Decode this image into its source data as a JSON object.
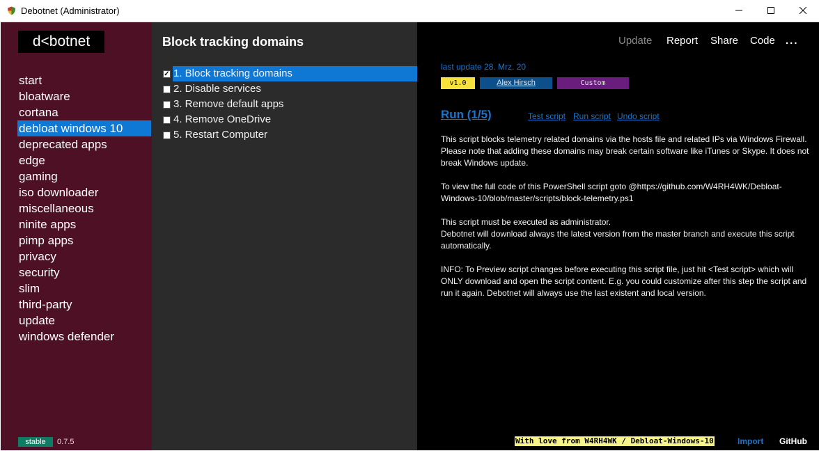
{
  "window": {
    "title": "Debotnet (Administrator)"
  },
  "sidebar": {
    "logo": "d<botnet",
    "items": [
      {
        "label": "start"
      },
      {
        "label": "bloatware"
      },
      {
        "label": "cortana"
      },
      {
        "label": "debloat windows 10",
        "active": true
      },
      {
        "label": "deprecated apps"
      },
      {
        "label": "edge"
      },
      {
        "label": "gaming"
      },
      {
        "label": "iso downloader"
      },
      {
        "label": "miscellaneous"
      },
      {
        "label": "ninite apps"
      },
      {
        "label": "pimp apps"
      },
      {
        "label": "privacy"
      },
      {
        "label": "security"
      },
      {
        "label": "slim"
      },
      {
        "label": "third-party"
      },
      {
        "label": "update"
      },
      {
        "label": "windows defender"
      }
    ],
    "channel": "stable",
    "version": "0.7.5"
  },
  "middle": {
    "heading": "Block tracking domains",
    "scripts": [
      {
        "label": "1. Block tracking domains",
        "checked": true,
        "selected": true
      },
      {
        "label": "2. Disable services",
        "checked": false
      },
      {
        "label": "3. Remove default apps",
        "checked": false
      },
      {
        "label": "4. Remove OneDrive",
        "checked": false
      },
      {
        "label": "5. Restart Computer",
        "checked": false
      }
    ]
  },
  "right": {
    "menu": {
      "update": "Update",
      "report": "Report",
      "share": "Share",
      "code": "Code",
      "more": "..."
    },
    "last_update": "last update 28. Mrz. 20",
    "tags": {
      "version": "v1.0",
      "author": "Alex Hirsch",
      "type": "Custom"
    },
    "run_label": "Run (1/5)",
    "actions": {
      "test": "Test script",
      "run": "Run script",
      "undo": "Undo script"
    },
    "description": [
      "This script blocks telemetry related domains via the hosts file and related IPs via Windows Firewall.",
      "Please note that adding these domains may break certain software like iTunes or Skype. It does not break Windows update.",
      "To view the full code of this PowerShell script goto @https://github.com/W4RH4WK/Debloat-Windows-10/blob/master/scripts/block-telemetry.ps1",
      "This script must be executed as administrator.",
      "Debotnet will download always the latest version from the master branch and execute this script automatically.",
      "INFO: To Preview script changes before executing this script file, just hit <Test script> which will ONLY download and open the script content. E.g. you could customize after this step the script and run it again. Debotnet will always use the last existent and local version."
    ],
    "footer": {
      "banner": "With love from W4RH4WK / Debloat-Windows-10",
      "import": "Import",
      "github": "GitHub"
    }
  },
  "colors": {
    "sidebar_bg": "#4d1024",
    "accent": "#0e78d4",
    "middle_bg": "#2b2b2b",
    "right_bg": "#000000",
    "link": "#1e73c8",
    "tag_version": "#f7e23c",
    "tag_author": "#0d4f8a",
    "tag_custom": "#6b1d7e",
    "stable_badge": "#0f7d63"
  },
  "icons": {
    "app": "shield-app-icon",
    "minimize": "minimize-icon",
    "maximize": "maximize-icon",
    "close": "close-icon"
  }
}
